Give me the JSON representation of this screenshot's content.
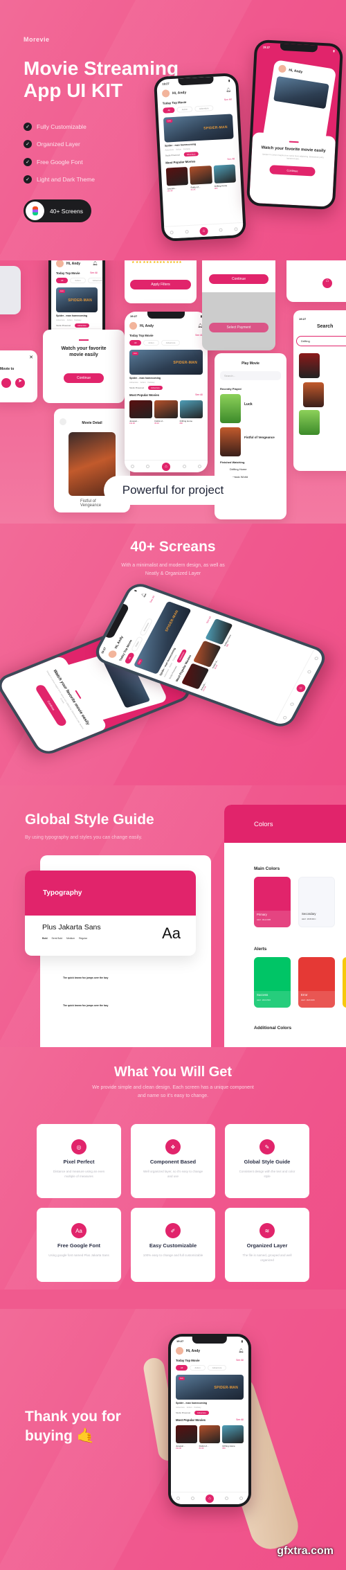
{
  "colors": {
    "background": "#f05a8e",
    "primary": "#e1246b",
    "dark": "#1c1c1f"
  },
  "hero": {
    "brand": "Morevie",
    "title_line1": "Movie Streaming",
    "title_line2": "App UI KIT",
    "features": [
      "Fully Customizable",
      "Organized Layer",
      "Free Google Font",
      "Light and Dark Theme"
    ],
    "badge": "40+ Screens",
    "badge_icon": "figma-logo-icon"
  },
  "phone": {
    "time": "19:27",
    "greeting": "Hi, Andy",
    "today_top": "Today Top Movie",
    "see_all": "See All",
    "chips": [
      "All",
      "Action",
      "Adventure"
    ],
    "live": "Live",
    "banner_title": "SPIDER-MAN",
    "movie_title": "Spider - man homecoming",
    "tags": [
      "Adventure",
      "Action",
      "Fantasy"
    ],
    "studio": "Studio Pinewood",
    "genre_btn": "Adventure",
    "popular": "Most Popular Movies",
    "posters": [
      {
        "title": "Jurassic...",
        "count": "191.9K",
        "color": "#5a1010"
      },
      {
        "title": "Fistful of...",
        "count": "83.4K",
        "color": "#b4502a"
      },
      {
        "title": "Drifting Home",
        "count": "80K",
        "color": "#4f9fb8"
      }
    ]
  },
  "onboarding": {
    "title": "Watch your favorite movie easily",
    "body": "Semper in cursus magna et eu varius nunc adipiscing. Elementum justo, laoreet id sem.",
    "button": "Continue"
  },
  "collage": {
    "apply_filters": "Apply Filters",
    "continue": "Continue",
    "select_payment": "Select Payment",
    "share_title": "Movie to",
    "movie_detail": "Movie Detail",
    "detail_title": "Fistful of Vengeance",
    "play_movie": "Play Movie",
    "search_placeholder": "Search...",
    "recently_played": "Recently Played",
    "luck": "Luck",
    "fistful": "Fistful of Vengeance",
    "finished": "Finished Watching",
    "drifting": "Drifting Home",
    "jurassic": "Jurassic World",
    "search_title": "Search",
    "search_value": "Drifting",
    "tagline": "Powerful for project"
  },
  "screens": {
    "title": "40+ Screans",
    "subtitle_line1": "With a minimalist and modern design, as well as",
    "subtitle_line2": "Neatly & Organized Layer"
  },
  "style_guide": {
    "title": "Global Style Guide",
    "subtitle": "By using typography and styles you can change easily.",
    "typography": "Typography",
    "font_name": "Plus Jakarta Sans",
    "weights": [
      "Bold",
      "Semi Bold",
      "Medium",
      "Regular"
    ],
    "sample_glyph": "Aa",
    "sample_text": "The quick brown fox jumps over the lazy",
    "colors_title": "Colors",
    "main_colors": "Main Colors",
    "alerts": "Alerts",
    "additional": "Additional Colors",
    "swatches": [
      {
        "name": "Primary",
        "hex": "HEX: #E1246B",
        "color": "#e1246b"
      },
      {
        "name": "Secondary",
        "hex": "HEX: #F8F9FC",
        "color": "#f6f7fb"
      },
      {
        "name": "Success",
        "hex": "HEX: #00C566",
        "color": "#00c566"
      },
      {
        "name": "Error",
        "hex": "HEX: #E53935",
        "color": "#e53935"
      }
    ]
  },
  "get": {
    "title": "What You Will Get",
    "subtitle_line1": "We provide simple and clean design. Each screen has a unique component",
    "subtitle_line2": "and name so it's easy to change.",
    "cards": [
      {
        "title": "Pixel Perfect",
        "desc": "Distance and measure using an even multiple of measures",
        "icon": "pixel-icon"
      },
      {
        "title": "Component Based",
        "desc": "Well organized layer, so it's easy to change and use",
        "icon": "component-icon"
      },
      {
        "title": "Global Style Guide",
        "desc": "Consistent design with the text and color style",
        "icon": "brush-icon"
      },
      {
        "title": "Free Google Font",
        "desc": "Using google font named Plus Jakarta Sans",
        "icon": "font-icon"
      },
      {
        "title": "Easy Customizable",
        "desc": "100% easy to change and full customizable",
        "icon": "edit-icon"
      },
      {
        "title": "Organized Layer",
        "desc": "The file is named, grouped and well organized",
        "icon": "layers-icon"
      }
    ]
  },
  "thanks": {
    "line1": "Thank you for",
    "line2": "buying",
    "emoji": "🤙",
    "watermark": "gfxtra.com"
  }
}
